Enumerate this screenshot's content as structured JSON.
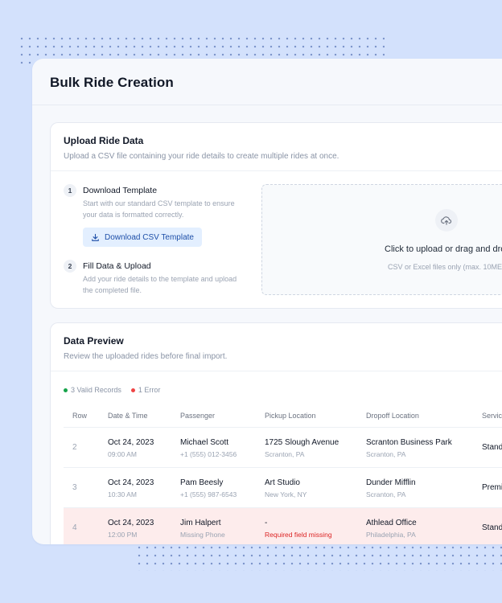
{
  "window": {
    "title": "Bulk Ride Creation"
  },
  "upload_card": {
    "title": "Upload Ride Data",
    "subtitle": "Upload a CSV file containing your ride details to create multiple rides at once.",
    "steps": [
      {
        "number": "1",
        "title": "Download Template",
        "description": "Start with our standard CSV template to ensure your data is formatted correctly.",
        "button_label": "Download CSV Template",
        "button_icon": "download-icon"
      },
      {
        "number": "2",
        "title": "Fill Data & Upload",
        "description": "Add your ride details to the template and upload the completed file."
      }
    ],
    "dropzone": {
      "icon": "upload-cloud-icon",
      "title": "Click to upload or drag and dro",
      "hint": "CSV or Excel files only (max. 10ME"
    }
  },
  "preview_card": {
    "title": "Data Preview",
    "subtitle": "Review the uploaded rides before final import.",
    "status": {
      "valid": "3 Valid Records",
      "error": "1 Error",
      "valid_color": "#16a34a",
      "error_color": "#ef4444"
    },
    "columns": [
      "Row",
      "Date & Time",
      "Passenger",
      "Pickup Location",
      "Dropoff Location",
      "Servic"
    ],
    "rows": [
      {
        "row": "2",
        "date": "Oct 24, 2023",
        "time": "09:00 AM",
        "passenger": "Michael Scott",
        "phone": "+1 (555) 012-3456",
        "pickup": "1725 Slough Avenue",
        "pickup_city": "Scranton, PA",
        "dropoff": "Scranton Business Park",
        "dropoff_city": "Scranton, PA",
        "service": "Stand",
        "error": false
      },
      {
        "row": "3",
        "date": "Oct 24, 2023",
        "time": "10:30 AM",
        "passenger": "Pam Beesly",
        "phone": "+1 (555) 987-6543",
        "pickup": "Art Studio",
        "pickup_city": "New York, NY",
        "dropoff": "Dunder Mifflin",
        "dropoff_city": "Scranton, PA",
        "service": "Premi",
        "error": false
      },
      {
        "row": "4",
        "date": "Oct 24, 2023",
        "time": "12:00 PM",
        "passenger": "Jim Halpert",
        "phone": "Missing Phone",
        "pickup": "-",
        "pickup_city": "Required field missing",
        "dropoff": "Athlead Office",
        "dropoff_city": "Philadelphia, PA",
        "service": "Stand",
        "error": true
      }
    ]
  }
}
